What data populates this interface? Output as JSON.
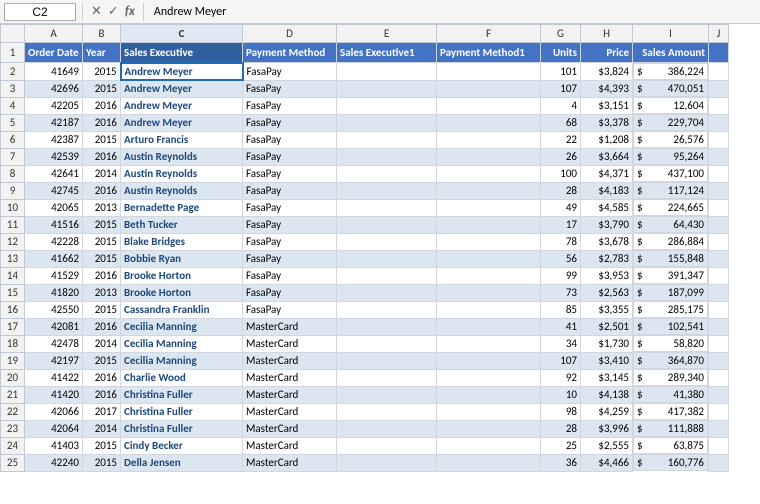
{
  "formula_bar": {
    "cell_ref": "C2",
    "formula_content": "Andrew Meyer",
    "icons": [
      "✕",
      "✓",
      "fx"
    ]
  },
  "columns": [
    "",
    "A",
    "B",
    "C",
    "D",
    "E",
    "F",
    "G",
    "H",
    "I",
    "J"
  ],
  "headers": {
    "row_num": "1",
    "A": "Order Date",
    "B": "Year",
    "C": "Sales Executive",
    "D": "Payment Method",
    "E": "Sales Executive1",
    "F": "Payment Method1",
    "G": "Units",
    "H": "Price",
    "I": "Sales Amount",
    "J": ""
  },
  "rows": [
    {
      "num": 2,
      "A": "41649",
      "B": "2015",
      "C": "Andrew Meyer",
      "D": "FasaPay",
      "E": "",
      "F": "",
      "G": "101",
      "H": "$3,824",
      "I": "$",
      "I2": "386,224"
    },
    {
      "num": 3,
      "A": "42696",
      "B": "2015",
      "C": "Andrew Meyer",
      "D": "FasaPay",
      "E": "",
      "F": "",
      "G": "107",
      "H": "$4,393",
      "I": "$",
      "I2": "470,051"
    },
    {
      "num": 4,
      "A": "42205",
      "B": "2016",
      "C": "Andrew Meyer",
      "D": "FasaPay",
      "E": "",
      "F": "",
      "G": "4",
      "H": "$3,151",
      "I": "$",
      "I2": "12,604"
    },
    {
      "num": 5,
      "A": "42187",
      "B": "2016",
      "C": "Andrew Meyer",
      "D": "FasaPay",
      "E": "",
      "F": "",
      "G": "68",
      "H": "$3,378",
      "I": "$",
      "I2": "229,704"
    },
    {
      "num": 6,
      "A": "42387",
      "B": "2015",
      "C": "Arturo Francis",
      "D": "FasaPay",
      "E": "",
      "F": "",
      "G": "22",
      "H": "$1,208",
      "I": "$",
      "I2": "26,576"
    },
    {
      "num": 7,
      "A": "42539",
      "B": "2016",
      "C": "Austin Reynolds",
      "D": "FasaPay",
      "E": "",
      "F": "",
      "G": "26",
      "H": "$3,664",
      "I": "$",
      "I2": "95,264"
    },
    {
      "num": 8,
      "A": "42641",
      "B": "2014",
      "C": "Austin Reynolds",
      "D": "FasaPay",
      "E": "",
      "F": "",
      "G": "100",
      "H": "$4,371",
      "I": "$",
      "I2": "437,100"
    },
    {
      "num": 9,
      "A": "42745",
      "B": "2016",
      "C": "Austin Reynolds",
      "D": "FasaPay",
      "E": "",
      "F": "",
      "G": "28",
      "H": "$4,183",
      "I": "$",
      "I2": "117,124"
    },
    {
      "num": 10,
      "A": "42065",
      "B": "2013",
      "C": "Bernadette Page",
      "D": "FasaPay",
      "E": "",
      "F": "",
      "G": "49",
      "H": "$4,585",
      "I": "$",
      "I2": "224,665"
    },
    {
      "num": 11,
      "A": "41516",
      "B": "2015",
      "C": "Beth Tucker",
      "D": "FasaPay",
      "E": "",
      "F": "",
      "G": "17",
      "H": "$3,790",
      "I": "$",
      "I2": "64,430"
    },
    {
      "num": 12,
      "A": "42228",
      "B": "2015",
      "C": "Blake Bridges",
      "D": "FasaPay",
      "E": "",
      "F": "",
      "G": "78",
      "H": "$3,678",
      "I": "$",
      "I2": "286,884"
    },
    {
      "num": 13,
      "A": "41662",
      "B": "2015",
      "C": "Bobbie Ryan",
      "D": "FasaPay",
      "E": "",
      "F": "",
      "G": "56",
      "H": "$2,783",
      "I": "$",
      "I2": "155,848"
    },
    {
      "num": 14,
      "A": "41529",
      "B": "2016",
      "C": "Brooke Horton",
      "D": "FasaPay",
      "E": "",
      "F": "",
      "G": "99",
      "H": "$3,953",
      "I": "$",
      "I2": "391,347"
    },
    {
      "num": 15,
      "A": "41820",
      "B": "2013",
      "C": "Brooke Horton",
      "D": "FasaPay",
      "E": "",
      "F": "",
      "G": "73",
      "H": "$2,563",
      "I": "$",
      "I2": "187,099"
    },
    {
      "num": 16,
      "A": "42550",
      "B": "2015",
      "C": "Cassandra Franklin",
      "D": "FasaPay",
      "E": "",
      "F": "",
      "G": "85",
      "H": "$3,355",
      "I": "$",
      "I2": "285,175"
    },
    {
      "num": 17,
      "A": "42081",
      "B": "2016",
      "C": "Cecilia Manning",
      "D": "MasterCard",
      "E": "",
      "F": "",
      "G": "41",
      "H": "$2,501",
      "I": "$",
      "I2": "102,541"
    },
    {
      "num": 18,
      "A": "42478",
      "B": "2014",
      "C": "Cecilia Manning",
      "D": "MasterCard",
      "E": "",
      "F": "",
      "G": "34",
      "H": "$1,730",
      "I": "$",
      "I2": "58,820"
    },
    {
      "num": 19,
      "A": "42197",
      "B": "2015",
      "C": "Cecilia Manning",
      "D": "MasterCard",
      "E": "",
      "F": "",
      "G": "107",
      "H": "$3,410",
      "I": "$",
      "I2": "364,870"
    },
    {
      "num": 20,
      "A": "41422",
      "B": "2016",
      "C": "Charlie Wood",
      "D": "MasterCard",
      "E": "",
      "F": "",
      "G": "92",
      "H": "$3,145",
      "I": "$",
      "I2": "289,340"
    },
    {
      "num": 21,
      "A": "41420",
      "B": "2016",
      "C": "Christina Fuller",
      "D": "MasterCard",
      "E": "",
      "F": "",
      "G": "10",
      "H": "$4,138",
      "I": "$",
      "I2": "41,380"
    },
    {
      "num": 22,
      "A": "42066",
      "B": "2017",
      "C": "Christina Fuller",
      "D": "MasterCard",
      "E": "",
      "F": "",
      "G": "98",
      "H": "$4,259",
      "I": "$",
      "I2": "417,382"
    },
    {
      "num": 23,
      "A": "42064",
      "B": "2014",
      "C": "Christina Fuller",
      "D": "MasterCard",
      "E": "",
      "F": "",
      "G": "28",
      "H": "$3,996",
      "I": "$",
      "I2": "111,888"
    },
    {
      "num": 24,
      "A": "41403",
      "B": "2015",
      "C": "Cindy Becker",
      "D": "MasterCard",
      "E": "",
      "F": "",
      "G": "25",
      "H": "$2,555",
      "I": "$",
      "I2": "63,875"
    },
    {
      "num": 25,
      "A": "42240",
      "B": "2015",
      "C": "Della Jensen",
      "D": "MasterCard",
      "E": "",
      "F": "",
      "G": "36",
      "H": "$4,466",
      "I": "$",
      "I2": "160,776"
    }
  ]
}
